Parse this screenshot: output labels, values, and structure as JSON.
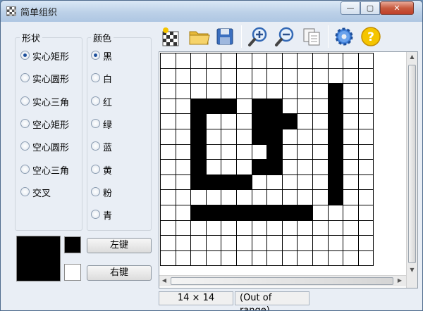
{
  "window": {
    "title": "简单组织",
    "controls": {
      "min": "—",
      "max": "▢",
      "close": "✕"
    }
  },
  "shape_group": {
    "title": "形状",
    "options": [
      {
        "label": "实心矩形",
        "checked": true
      },
      {
        "label": "实心圆形",
        "checked": false
      },
      {
        "label": "实心三角",
        "checked": false
      },
      {
        "label": "空心矩形",
        "checked": false
      },
      {
        "label": "空心圆形",
        "checked": false
      },
      {
        "label": "空心三角",
        "checked": false
      },
      {
        "label": "交叉",
        "checked": false
      }
    ]
  },
  "color_group": {
    "title": "颜色",
    "options": [
      {
        "label": "黑",
        "checked": true
      },
      {
        "label": "白",
        "checked": false
      },
      {
        "label": "红",
        "checked": false
      },
      {
        "label": "绿",
        "checked": false
      },
      {
        "label": "蓝",
        "checked": false
      },
      {
        "label": "黄",
        "checked": false
      },
      {
        "label": "粉",
        "checked": false
      },
      {
        "label": "青",
        "checked": false
      }
    ]
  },
  "colors": {
    "preview": "#000000",
    "left": "#000000",
    "right": "#ffffff"
  },
  "buttons": {
    "left_key": "左键",
    "right_key": "右键"
  },
  "toolbar": {
    "icons": [
      "new-grid-icon",
      "open-folder-icon",
      "save-disk-icon",
      "zoom-in-icon",
      "zoom-out-icon",
      "copy-icon",
      "settings-gear-icon",
      "help-icon"
    ]
  },
  "canvas": {
    "rows": 14,
    "cols": 14,
    "pixels": [
      "..............",
      "..............",
      "...........#..",
      "..###.##...#..",
      "..#...###..#..",
      "..#...##...#..",
      "..#....#...#..",
      "..#...##...#..",
      "..####.....#..",
      "...........#..",
      "..########....",
      "..............",
      "..............",
      ".............."
    ]
  },
  "status": {
    "size": "14 × 14",
    "position": "(Out of range)"
  }
}
